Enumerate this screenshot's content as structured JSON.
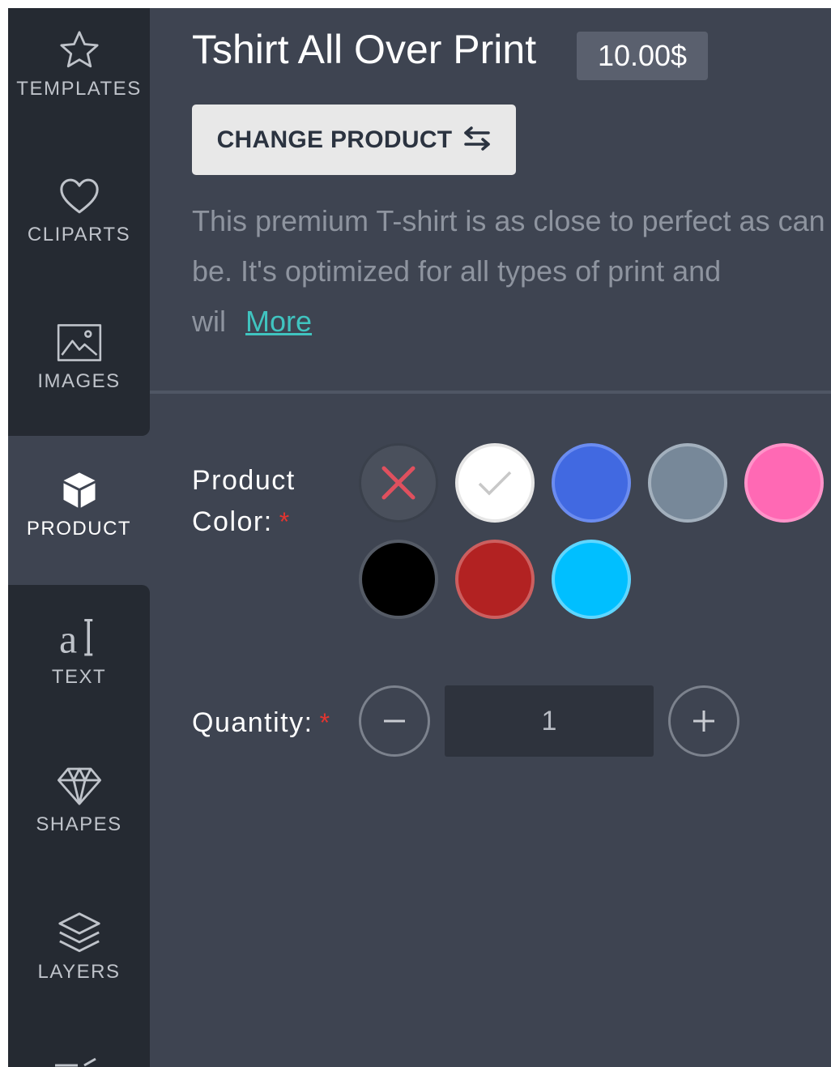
{
  "sidebar": {
    "items": [
      {
        "label": "TEMPLATES",
        "icon": "star-icon"
      },
      {
        "label": "CLIPARTS",
        "icon": "heart-icon"
      },
      {
        "label": "IMAGES",
        "icon": "image-icon"
      },
      {
        "label": "PRODUCT",
        "icon": "cube-icon",
        "active": true
      },
      {
        "label": "TEXT",
        "icon": "text-icon"
      },
      {
        "label": "SHAPES",
        "icon": "diamond-icon"
      },
      {
        "label": "LAYERS",
        "icon": "layers-icon"
      }
    ]
  },
  "product": {
    "title": "Tshirt All Over Print",
    "price": "10.00$",
    "change_label": "CHANGE PRODUCT",
    "description": "This premium T-shirt is as close to perfect as can be. It's optimized for all types of print and wil",
    "more_label": "More"
  },
  "color_field": {
    "label_line1": "Product",
    "label_line2": "Color:",
    "required_mark": "*",
    "swatches": [
      {
        "name": "none",
        "color": "#4a505c"
      },
      {
        "name": "white",
        "color": "#ffffff",
        "selected": true
      },
      {
        "name": "blue",
        "color": "#4169e1"
      },
      {
        "name": "gray",
        "color": "#778899"
      },
      {
        "name": "pink",
        "color": "#ff69b4"
      },
      {
        "name": "black",
        "color": "#000000"
      },
      {
        "name": "red",
        "color": "#b22222"
      },
      {
        "name": "sky-blue",
        "color": "#00bfff"
      }
    ]
  },
  "quantity_field": {
    "label": "Quantity:",
    "required_mark": "*",
    "value": "1"
  }
}
